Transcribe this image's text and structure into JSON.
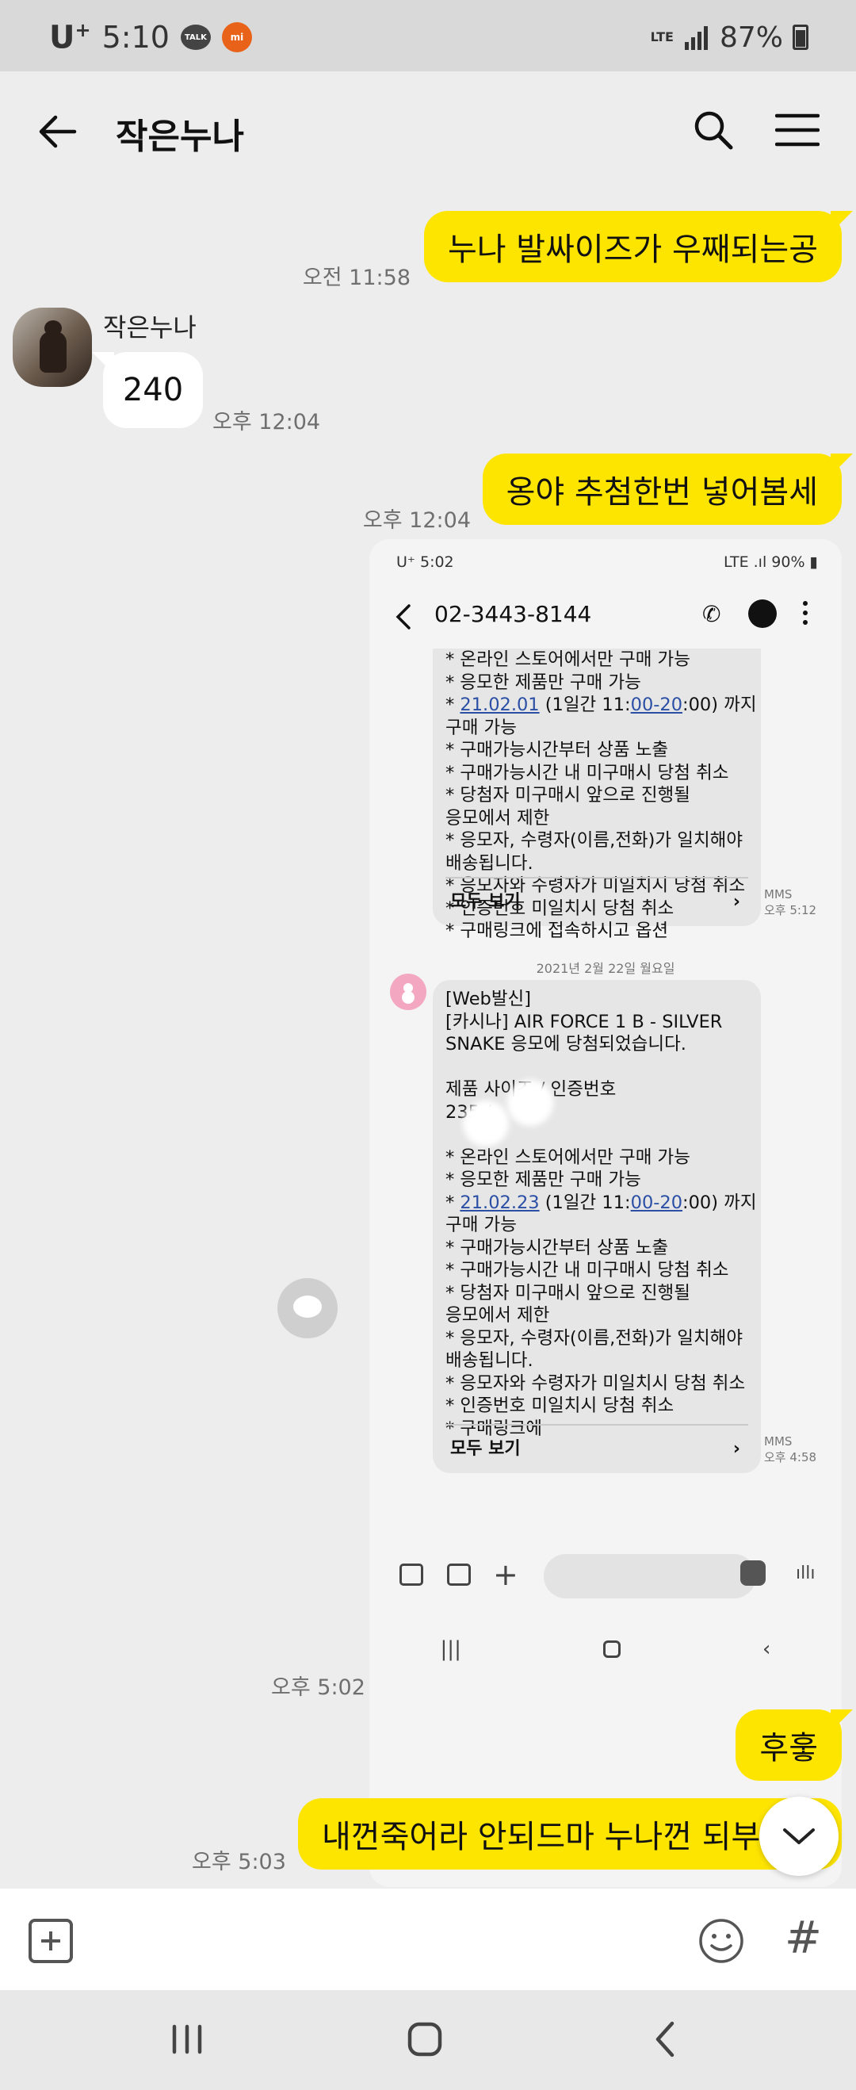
{
  "status_bar": {
    "carrier": "U",
    "carrier_sup": "+",
    "time": "5:10",
    "talk_badge": "TALK",
    "mi_badge": "mi",
    "network": "LTE",
    "battery": "87%"
  },
  "header": {
    "title": "작은누나"
  },
  "messages": {
    "m1": {
      "text": "누나 발싸이즈가 우째되는공",
      "time": "오전 11:58"
    },
    "sender_name": "작은누나",
    "m2": {
      "text": "240",
      "time": "오후 12:04"
    },
    "m3": {
      "text": "옹야 추첨한번 넣어봄세",
      "time": "오후 12:04"
    },
    "m4_time": "오후 5:02",
    "m5": {
      "text": "후훟"
    },
    "m6": {
      "text": "내껀죽어라 안되드마 누나껀 되부렀",
      "time": "오후 5:03"
    }
  },
  "shot": {
    "status_left": "U⁺ 5:02",
    "status_right": "90%",
    "number": "02-3443-8144",
    "sms1_lines": [
      "* 온라인 스토어에서만 구매 가능",
      "* 응모한 제품만 구매 가능"
    ],
    "sms1_date_prefix": "* ",
    "sms1_date": "21.02.01",
    "sms1_date_mid": " (1일간  11:",
    "sms1_date_time": "00-20",
    "sms1_date_suffix": ":00) 까지",
    "sms1_lines2": [
      "구매 가능",
      "* 구매가능시간부터 상품 노출",
      "* 구매가능시간 내 미구매시 당첨 취소",
      "* 당첨자 미구매시 앞으로 진행될",
      "응모에서 제한",
      "* 응모자, 수령자(이름,전화)가 일치해야",
      "배송됩니다.",
      "* 응모자와 수령자가 미일치시 당첨 취소",
      "* 인증번호 미일치시 당첨 취소",
      "* 구매링크에 접속하시고 옵션"
    ],
    "see_all": "모두 보기",
    "sms1_meta_type": "MMS",
    "sms1_meta_time": "오후 5:12",
    "date_divider": "2021년 2월 22일 월요일",
    "sms2_lines": [
      "[Web발신]",
      "[카시나] AIR FORCE 1 B - SILVER",
      "SNAKE 응모에 당첨되었습니다.",
      "",
      "제품 사이즈 / 인증번호",
      "235 /",
      "",
      "* 온라인 스토어에서만 구매 가능",
      "* 응모한 제품만 구매 가능"
    ],
    "sms2_date": "21.02.23",
    "sms2_date_mid": " (1일간 11:",
    "sms2_date_time": "00-20",
    "sms2_lines2": [
      "구매 가능",
      "* 구매가능시간부터 상품 노출",
      "* 구매가능시간 내 미구매시 당첨 취소",
      "* 당첨자 미구매시 앞으로 진행될",
      "응모에서 제한",
      "* 응모자, 수령자(이름,전화)가 일치해야",
      "배송됩니다.",
      "* 응모자와 수령자가 미일치시 당첨 취소",
      "* 인증번호 미일치시 당첨 취소",
      "* 구매링크에"
    ],
    "sms2_meta_time": "오후 4:58"
  },
  "composer": {
    "placeholder": ""
  },
  "colors": {
    "my_bubble": "#fee500",
    "background": "#ededed"
  }
}
